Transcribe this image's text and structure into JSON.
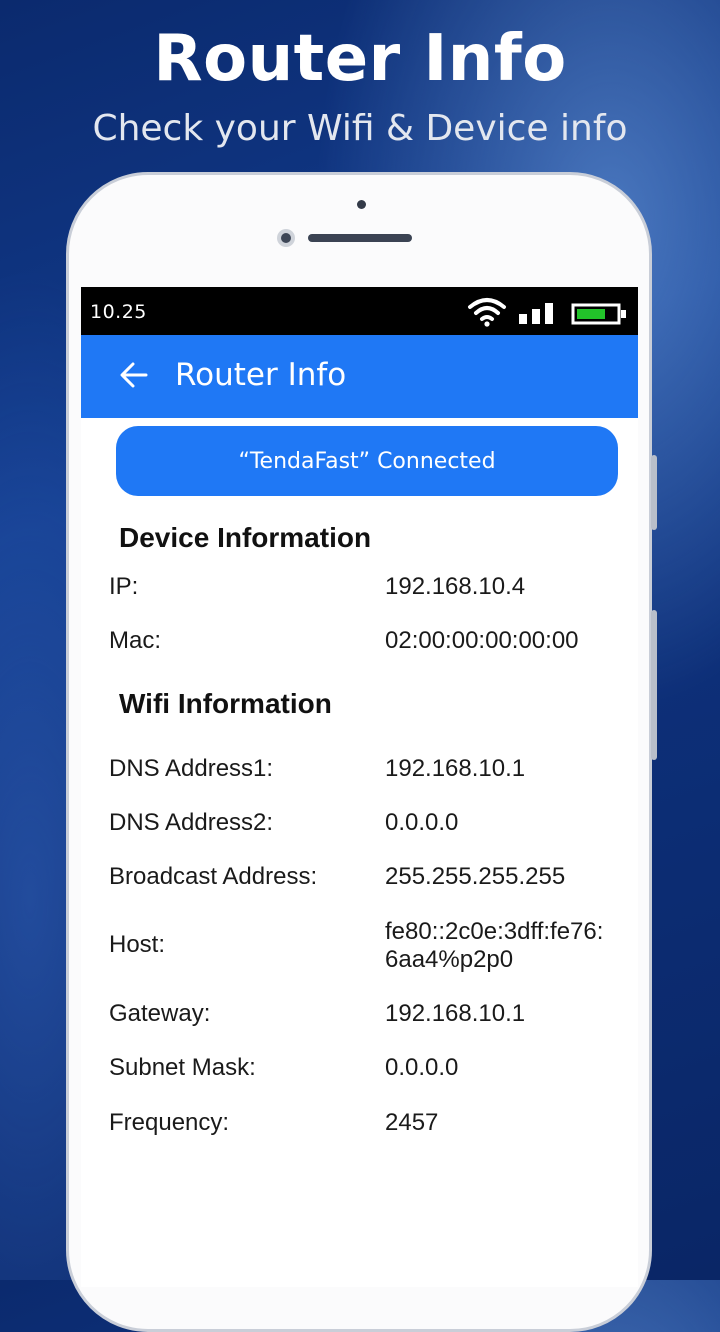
{
  "promo": {
    "title": "Router Info",
    "subtitle": "Check your Wifi & Device info"
  },
  "statusbar": {
    "time": "10.25",
    "icons": [
      "wifi-icon",
      "signal-icon",
      "battery-icon"
    ],
    "battery_color": "#22c32a"
  },
  "appbar": {
    "title": "Router Info",
    "back_icon": "arrow-left-icon",
    "color": "#1f78f5"
  },
  "connection": {
    "label": "“TendaFast” Connected"
  },
  "device_info": {
    "title": "Device Information",
    "rows": [
      {
        "label": "IP:",
        "value": "192.168.10.4"
      },
      {
        "label": "Mac:",
        "value": "02:00:00:00:00:00"
      }
    ]
  },
  "wifi_info": {
    "title": "Wifi Information",
    "rows": [
      {
        "label": "DNS Address1:",
        "value": "192.168.10.1"
      },
      {
        "label": "DNS Address2:",
        "value": "0.0.0.0"
      },
      {
        "label": "Broadcast Address:",
        "value": "255.255.255.255"
      },
      {
        "label": "Host:",
        "value": "fe80::2c0e:3dff:fe76:",
        "value_line2": "6aa4%p2p0"
      },
      {
        "label": "Gateway:",
        "value": "192.168.10.1"
      },
      {
        "label": "Subnet Mask:",
        "value": "0.0.0.0"
      },
      {
        "label": "Frequency:",
        "value": "2457"
      }
    ]
  }
}
